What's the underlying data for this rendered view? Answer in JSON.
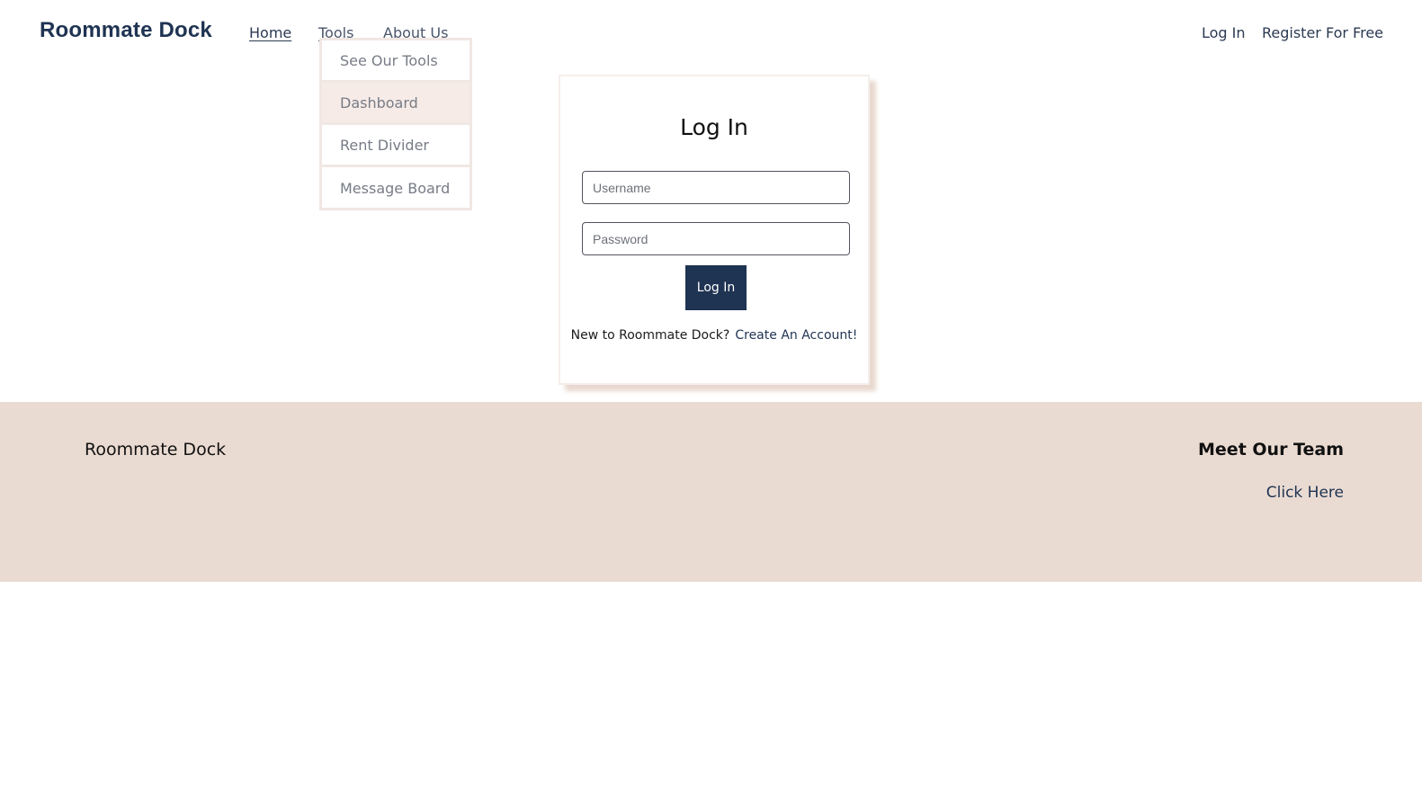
{
  "header": {
    "logo": "Roommate Dock",
    "nav": {
      "home": "Home",
      "tools": "Tools",
      "about": "About Us"
    },
    "auth": {
      "login": "Log In",
      "register": "Register For Free"
    }
  },
  "tools_menu": {
    "items": [
      {
        "label": "See Our Tools"
      },
      {
        "label": "Dashboard"
      },
      {
        "label": "Rent Divider"
      },
      {
        "label": "Message Board"
      }
    ],
    "highlighted_item": "Dashboard"
  },
  "login_card": {
    "title": "Log In",
    "username": {
      "value": "",
      "placeholder": "Username"
    },
    "password": {
      "value": "",
      "placeholder": "Password"
    },
    "submit_label": "Log In",
    "signup_prompt": "New to Roommate Dock?",
    "signup_link": "Create An Account!"
  },
  "footer": {
    "brand": "Roommate Dock",
    "team_heading": "Meet Our Team",
    "team_link": "Click Here"
  },
  "colors": {
    "brand_navy": "#1f3352",
    "footer_bg": "#eadbd2",
    "menu_highlight": "#f6ebe7"
  }
}
